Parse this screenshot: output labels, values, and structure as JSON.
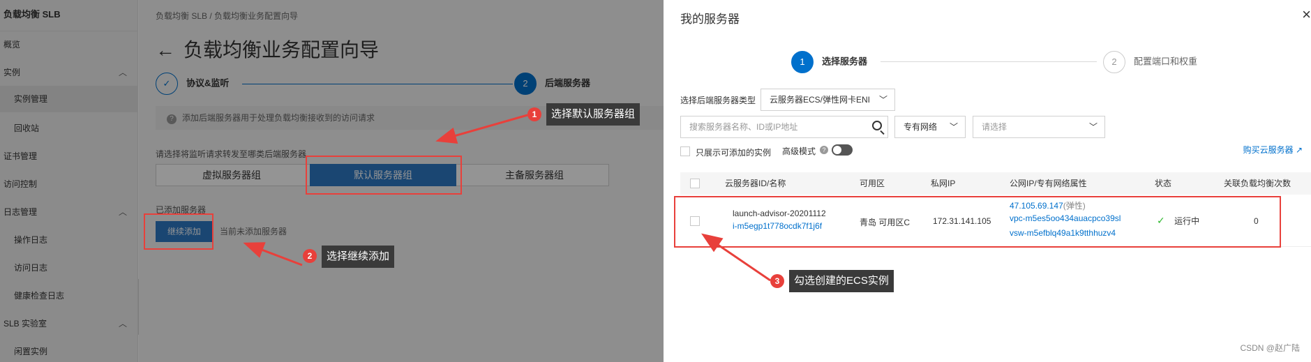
{
  "sidebar": {
    "title": "负载均衡 SLB",
    "items": [
      {
        "label": "概览"
      },
      {
        "label": "实例"
      },
      {
        "label": "实例管理"
      },
      {
        "label": "回收站"
      },
      {
        "label": "证书管理"
      },
      {
        "label": "访问控制"
      },
      {
        "label": "日志管理"
      },
      {
        "label": "操作日志"
      },
      {
        "label": "访问日志"
      },
      {
        "label": "健康检查日志"
      },
      {
        "label": "SLB 实验室"
      },
      {
        "label": "闲置实例"
      }
    ]
  },
  "main": {
    "breadcrumb": "负载均衡 SLB  /  负载均衡业务配置向导",
    "title": "负载均衡业务配置向导",
    "steps": [
      {
        "label": "协议&监听"
      },
      {
        "number": "2",
        "label": "后端服务器"
      }
    ],
    "hint": "添加后端服务器用于处理负载均衡接收到的访问请求",
    "group_prompt": "请选择将监听请求转发至哪类后端服务器",
    "tabs": [
      {
        "label": "虚拟服务器组"
      },
      {
        "label": "默认服务器组"
      },
      {
        "label": "主备服务器组"
      }
    ],
    "added_label": "已添加服务器",
    "continue_label": "继续添加",
    "empty_text": "当前未添加服务器"
  },
  "drawer": {
    "title": "我的服务器",
    "close": "×",
    "steps": [
      {
        "number": "1",
        "label": "选择服务器"
      },
      {
        "number": "2",
        "label": "配置端口和权重"
      }
    ],
    "filter_label": "选择后端服务器类型",
    "type_select": "云服务器ECS/弹性网卡ENI",
    "search_placeholder": "搜索服务器名称、ID或IP地址",
    "network_select": "专有网络",
    "vpc_select_placeholder": "请选择",
    "only_show_addable": "只展示可添加的实例",
    "advanced_mode": "高级模式",
    "buy_link": "购买云服务器",
    "table": {
      "headers": [
        "云服务器ID/名称",
        "可用区",
        "私网IP",
        "公网IP/专有网络属性",
        "状态",
        "关联负载均衡次数"
      ],
      "row": {
        "name": "launch-advisor-20201112",
        "id": "i-m5egp1t778ocdk7f1j6f",
        "zone": "青岛 可用区C",
        "private_ip": "172.31.141.105",
        "public_ip": "47.105.69.147",
        "public_ip_tag": "(弹性)",
        "vpc": "vpc-m5es5oo434auacpco39sl",
        "vsw": "vsw-m5efblq49a1k9tthhuzv4",
        "status": "运行中",
        "lb_count": "0"
      }
    }
  },
  "annotations": [
    {
      "number": "1",
      "text": "选择默认服务器组"
    },
    {
      "number": "2",
      "text": "选择继续添加"
    },
    {
      "number": "3",
      "text": "勾选创建的ECS实例"
    }
  ],
  "watermark": "CSDN @赵广陆",
  "colors": {
    "accent": "#0070cc",
    "annotation": "#e8403b",
    "status_ok": "#2eb82e"
  }
}
